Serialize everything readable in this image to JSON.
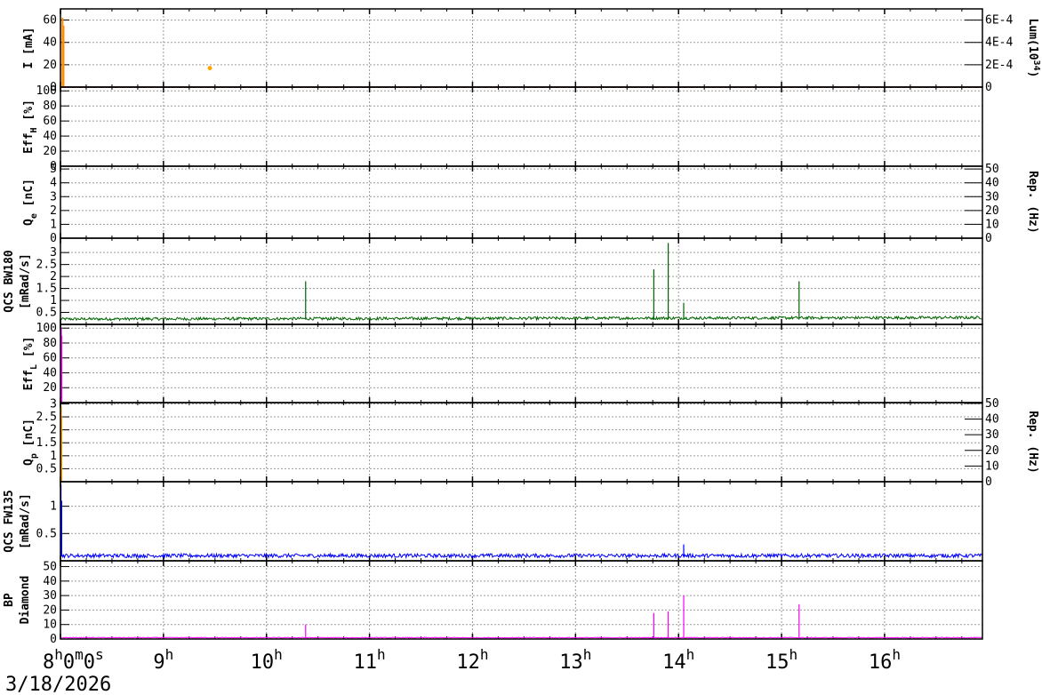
{
  "chart_data": {
    "type": "line",
    "date": "3/18/2026",
    "x_axis": {
      "ticks": [
        {
          "hour": 8,
          "main": "8",
          "sup": "h",
          "rest": "0",
          "sup2": "m",
          "rest2": "0",
          "sup3": "s"
        },
        {
          "hour": 9,
          "main": "9",
          "sup": "h"
        },
        {
          "hour": 10,
          "main": "10",
          "sup": "h"
        },
        {
          "hour": 11,
          "main": "11",
          "sup": "h"
        },
        {
          "hour": 12,
          "main": "12",
          "sup": "h"
        },
        {
          "hour": 13,
          "main": "13",
          "sup": "h"
        },
        {
          "hour": 14,
          "main": "14",
          "sup": "h"
        },
        {
          "hour": 15,
          "main": "15",
          "sup": "h"
        },
        {
          "hour": 16,
          "main": "16",
          "sup": "h"
        }
      ],
      "range_hours": [
        8.0,
        16.95
      ]
    },
    "panels": [
      {
        "id": "current",
        "ylabel": "I [mA]",
        "ylim": [
          0,
          70
        ],
        "yticks": [
          0,
          20,
          40,
          60
        ],
        "ytick_labels": [
          "0",
          "20",
          "40",
          "60"
        ],
        "right_ylabel": "Lum(10",
        "right_ylabel_sup": "34",
        "right_ylabel_tail": ")",
        "right_ylim": [
          0,
          0.0007
        ],
        "right_yticks": [
          0,
          0.0002,
          0.0004,
          0.0006
        ],
        "right_ytick_labels": [
          "0",
          "2E-4",
          "4E-4",
          "6E-4"
        ],
        "series": [
          {
            "color": "#ffa500",
            "kind": "points",
            "points": [
              [
                9.45,
                17
              ]
            ]
          },
          {
            "color": "#cc0000",
            "kind": "line",
            "points": [
              [
                8.0,
                0
              ],
              [
                16.95,
                0
              ]
            ]
          },
          {
            "color": "#ff8c00",
            "kind": "spike",
            "points": [
              [
                8.02,
                62
              ],
              [
                8.03,
                55
              ]
            ]
          }
        ]
      },
      {
        "id": "eff_h",
        "ylabel": "Eff",
        "ylabel_sub": "H",
        "ylabel_tail": " [%]",
        "ylim": [
          0,
          105
        ],
        "yticks": [
          0,
          20,
          40,
          60,
          80,
          100
        ],
        "ytick_labels": [
          "0",
          "20",
          "40",
          "60",
          "80",
          "100"
        ],
        "series": []
      },
      {
        "id": "qe",
        "ylabel": "Q",
        "ylabel_sub": "e",
        "ylabel_tail": " [nC]",
        "ylim": [
          0,
          5.2
        ],
        "yticks": [
          0,
          1,
          2,
          3,
          4,
          5
        ],
        "ytick_labels": [
          "0",
          "1",
          "2",
          "3",
          "4",
          "5"
        ],
        "right_ylabel": "Rep. (Hz)",
        "right_ylim": [
          0,
          52
        ],
        "right_yticks": [
          0,
          10,
          20,
          30,
          40,
          50
        ],
        "right_ytick_labels": [
          "0",
          "10",
          "20",
          "30",
          "40",
          "50"
        ],
        "series": []
      },
      {
        "id": "qcs_bw180",
        "ylabel": "QCS BW180",
        "ylabel2": "[mRad/s]",
        "ylim": [
          0,
          3.6
        ],
        "yticks": [
          0.5,
          1,
          1.5,
          2,
          2.5,
          3
        ],
        "ytick_labels": [
          "0.5",
          "1",
          "1.5",
          "2",
          "2.5",
          "3"
        ],
        "noise": {
          "color": "#006400",
          "base": 0.2,
          "amplitude": 0.12,
          "trend": 0.06
        },
        "spikes": [
          {
            "x": 10.38,
            "y": 1.8
          },
          {
            "x": 13.76,
            "y": 2.3
          },
          {
            "x": 13.9,
            "y": 3.4
          },
          {
            "x": 14.05,
            "y": 0.9
          },
          {
            "x": 15.17,
            "y": 1.8
          }
        ]
      },
      {
        "id": "eff_l",
        "ylabel": "Eff",
        "ylabel_sub": "L",
        "ylabel_tail": " [%]",
        "ylim": [
          0,
          105
        ],
        "yticks": [
          20,
          40,
          60,
          80,
          100
        ],
        "ytick_labels": [
          "20",
          "40",
          "60",
          "80",
          "100"
        ],
        "series": [
          {
            "color": "#ff00ff",
            "kind": "spike",
            "points": [
              [
                8.005,
                100
              ],
              [
                8.01,
                90
              ]
            ]
          }
        ]
      },
      {
        "id": "qp",
        "ylabel": "Q",
        "ylabel_sub": "p",
        "ylabel_tail": " [nC]",
        "ylim": [
          0,
          3.05
        ],
        "yticks": [
          0.5,
          1,
          1.5,
          2,
          2.5,
          3
        ],
        "ytick_labels": [
          "0.5",
          "1",
          "1.5",
          "2",
          "2.5",
          "3"
        ],
        "right_ylabel": "Rep. (Hz)",
        "right_ylim": [
          0,
          50.5
        ],
        "right_yticks": [
          0,
          10,
          20,
          30,
          40,
          50
        ],
        "right_ytick_labels": [
          "0",
          "10",
          "20",
          "30",
          "40",
          "50"
        ],
        "series": [
          {
            "color": "#ffa500",
            "kind": "spike",
            "points": [
              [
                8.005,
                2.9
              ],
              [
                8.01,
                2.5
              ]
            ]
          }
        ]
      },
      {
        "id": "qcs_fw135",
        "ylabel": "QCS FW135",
        "ylabel2": "[mRad/s]",
        "ylim": [
          0,
          1.45
        ],
        "yticks": [
          0.5,
          1
        ],
        "ytick_labels": [
          "0.5",
          "1"
        ],
        "noise": {
          "color": "#0000ff",
          "base": 0.08,
          "amplitude": 0.07,
          "trend": 0.0
        },
        "spikes": [
          {
            "x": 8.005,
            "y": 1.4
          },
          {
            "x": 8.012,
            "y": 1.1
          },
          {
            "x": 14.05,
            "y": 0.3
          }
        ]
      },
      {
        "id": "bp_diamond",
        "ylabel": "BP",
        "ylabel2": "Diamond",
        "ylim": [
          0,
          54
        ],
        "yticks": [
          0,
          10,
          20,
          30,
          40,
          50
        ],
        "ytick_labels": [
          "0",
          "10",
          "20",
          "30",
          "40",
          "50"
        ],
        "noise": {
          "color": "#ff00ff",
          "base": 0.8,
          "amplitude": 0.6,
          "trend": 0.0
        },
        "spikes": [
          {
            "x": 10.38,
            "y": 10
          },
          {
            "x": 13.76,
            "y": 18
          },
          {
            "x": 13.9,
            "y": 19
          },
          {
            "x": 14.05,
            "y": 30
          },
          {
            "x": 15.17,
            "y": 24
          }
        ]
      }
    ]
  }
}
